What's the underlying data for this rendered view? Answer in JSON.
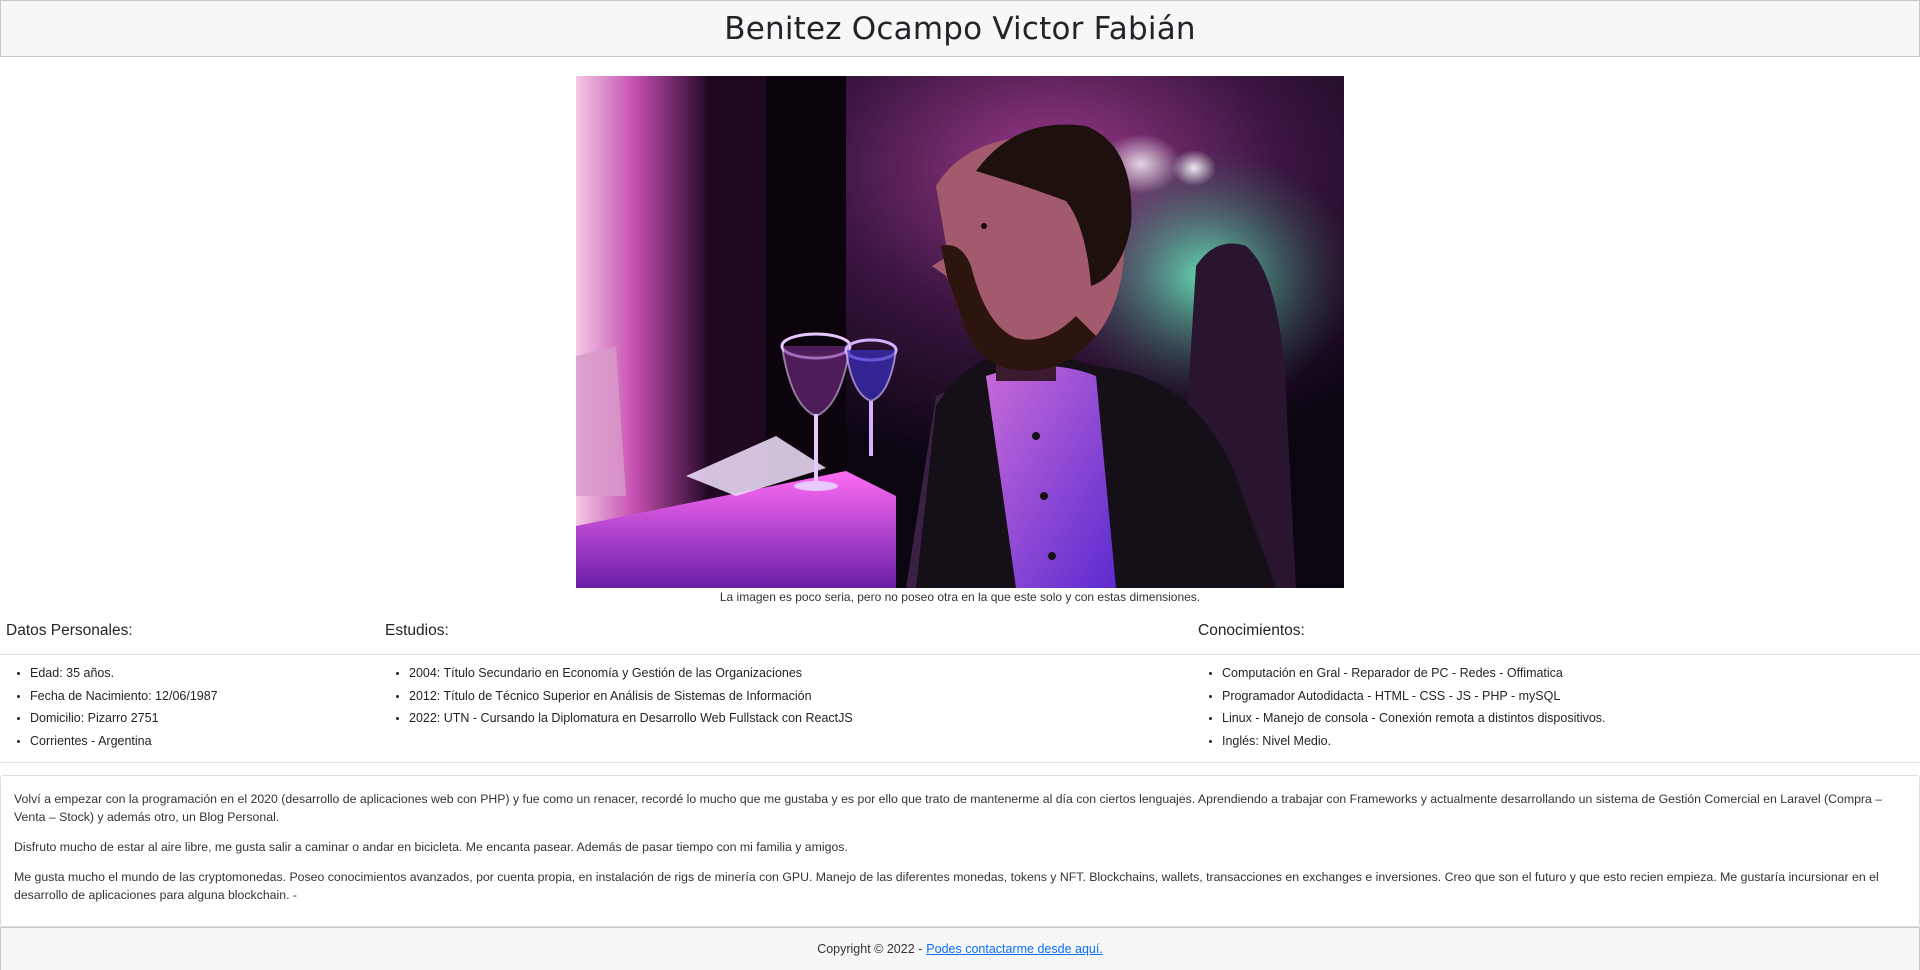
{
  "header": {
    "title": "Benitez Ocampo Victor Fabián"
  },
  "photo": {
    "caption": "La imagen es poco seria, pero no poseo otra en la que este solo y con estas dimensiones."
  },
  "sections": {
    "personal": {
      "title": "Datos Personales:",
      "items": [
        "Edad: 35 años.",
        "Fecha de Nacimiento: 12/06/1987",
        "Domicilio: Pizarro 2751",
        "Corrientes - Argentina"
      ]
    },
    "studies": {
      "title": "Estudios:",
      "items": [
        "2004: Título Secundario en Economía y Gestión de las Organizaciones",
        "2012: Título de Técnico Superior en Análisis de Sistemas de Información",
        "2022: UTN - Cursando la Diplomatura en Desarrollo Web Fullstack con ReactJS"
      ]
    },
    "skills": {
      "title": "Conocimientos:",
      "items": [
        "Computación en Gral - Reparador de PC - Redes - Offimatica",
        "Programador Autodidacta - HTML - CSS - JS - PHP - mySQL",
        "Linux - Manejo de consola - Conexión remota a distintos dispositivos.",
        "Inglés: Nivel Medio."
      ]
    }
  },
  "bio": {
    "paragraphs": [
      "Volví a empezar con la programación en el 2020 (desarrollo de aplicaciones web con PHP) y fue como un renacer, recordé lo mucho que me gustaba y es por ello que trato de mantenerme al día con ciertos lenguajes. Aprendiendo a trabajar con Frameworks y actualmente desarrollando un sistema de Gestión Comercial en Laravel (Compra – Venta – Stock) y además otro, un Blog Personal.",
      "Disfruto mucho de estar al aire libre, me gusta salir a caminar o andar en bicicleta. Me encanta pasear. Además de pasar tiempo con mi familia y amigos.",
      "Me gusta mucho el mundo de las cryptomonedas. Poseo conocimientos avanzados, por cuenta propia, en instalación de rigs de minería con GPU. Manejo de las diferentes monedas, tokens y NFT. Blockchains, wallets, transacciones en exchanges e inversiones. Creo que son el futuro y que esto recien empieza. Me gustaría incursionar en el desarrollo de aplicaciones para alguna blockchain. -"
    ]
  },
  "footer": {
    "copyright": "Copyright © 2022 -",
    "contact_link": "Podes contactarme desde aquí."
  }
}
